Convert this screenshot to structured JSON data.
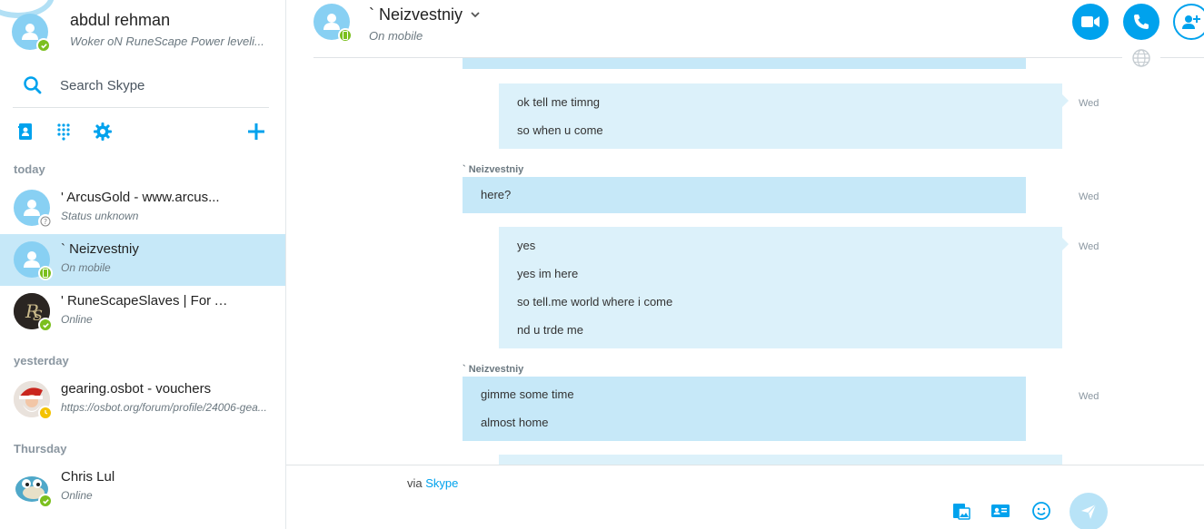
{
  "profile": {
    "name": "abdul rehman",
    "mood": "Woker oN RuneScape Power leveli..."
  },
  "search": {
    "placeholder": "Search Skype"
  },
  "sidebar": {
    "sections": [
      {
        "label": "today",
        "contacts": [
          {
            "name": "' ArcusGold - www.arcus...",
            "status": "Status unknown",
            "presence": "unknown"
          },
          {
            "name": "` Neizvestniy",
            "status": "On mobile",
            "presence": "mobile",
            "active": true
          },
          {
            "name": "' RuneScapeSlaves | For A...",
            "status": "Online",
            "presence": "online"
          }
        ]
      },
      {
        "label": "yesterday",
        "contacts": [
          {
            "name": "gearing.osbot - vouchers",
            "status": "https://osbot.org/forum/profile/24006-gea...",
            "presence": "away"
          }
        ]
      },
      {
        "label": "Thursday",
        "contacts": [
          {
            "name": "Chris Lul",
            "status": "Online",
            "presence": "online"
          }
        ]
      }
    ]
  },
  "conversation": {
    "name": "` Neizvestniy",
    "status": "On mobile",
    "messages": [
      {
        "direction": "out",
        "lines": [
          "ok tell me timng",
          "so when u come"
        ],
        "time": "Wed"
      },
      {
        "direction": "in",
        "sender": "` Neizvestniy",
        "lines": [
          "here?"
        ],
        "time": "Wed"
      },
      {
        "direction": "out",
        "lines": [
          "yes",
          "yes im here",
          "so tell.me world where i come",
          "nd u trde me"
        ],
        "time": "Wed"
      },
      {
        "direction": "in",
        "sender": "` Neizvestniy",
        "lines": [
          "gimme some time",
          "almost home"
        ],
        "time": "Wed"
      }
    ]
  },
  "composer": {
    "via_prefix": "via",
    "via_link": "Skype"
  },
  "colors": {
    "accent": "#00a2ed",
    "online": "#7bbf1e",
    "away": "#f4c200",
    "bubble_in": "#c6e8f8",
    "bubble_out": "#dcf1fa"
  }
}
